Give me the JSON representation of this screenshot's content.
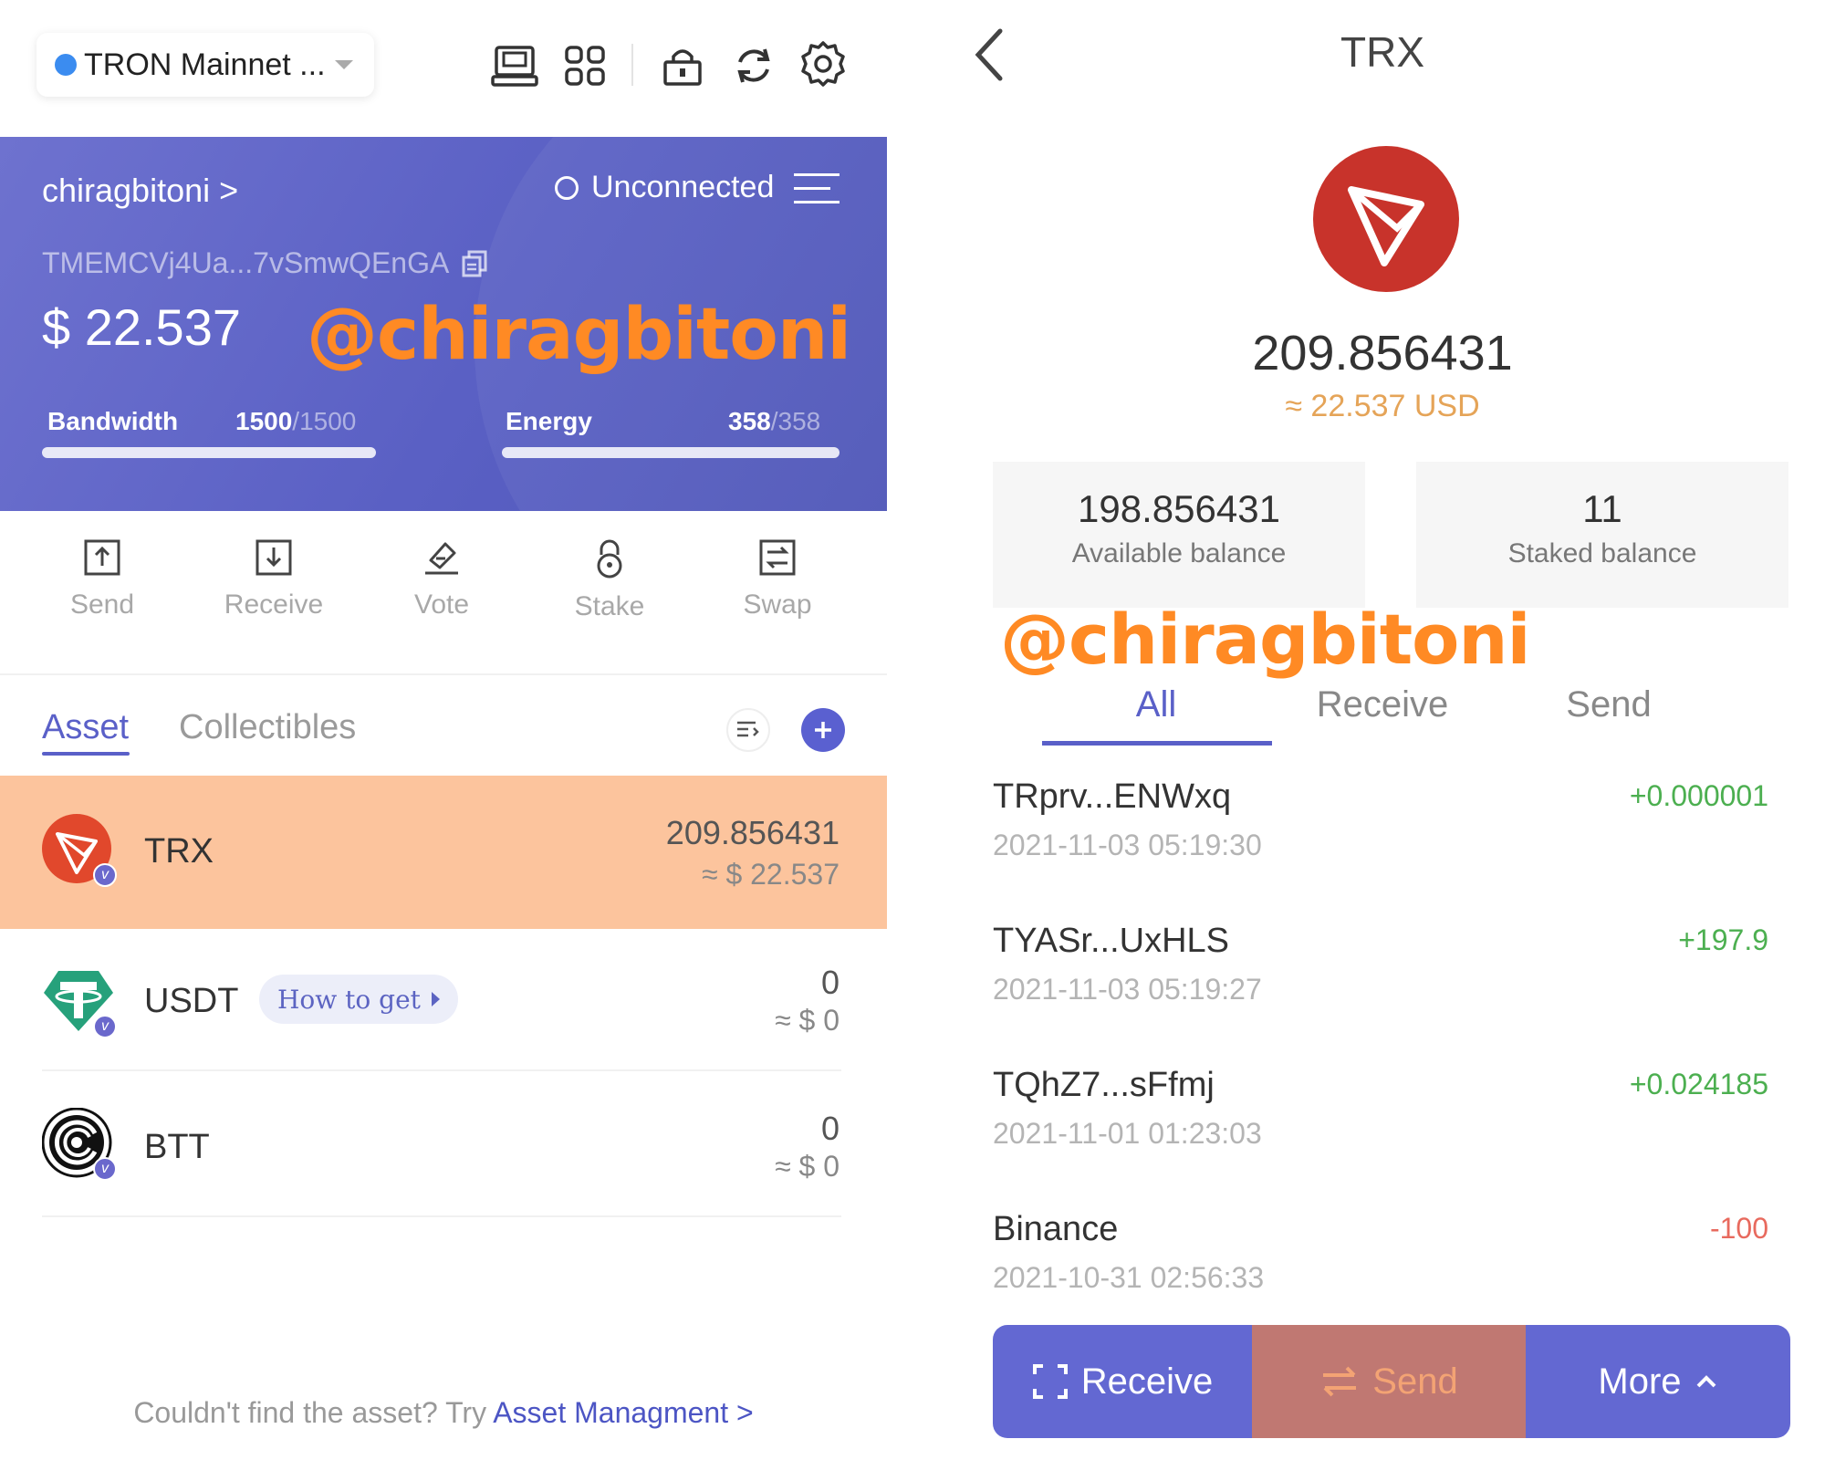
{
  "header": {
    "network": "TRON Mainnet ...",
    "icons": [
      "device-icon",
      "apps-grid-icon",
      "lock-icon",
      "refresh-icon",
      "gear-icon"
    ]
  },
  "account": {
    "name": "chiragbitoni >",
    "status": "Unconnected",
    "address": "TMEMCVj4Ua...7vSmwQEnGA",
    "balance": "$ 22.537",
    "watermark": "@chiragbitoni",
    "bandwidth": {
      "label": "Bandwidth",
      "value": "1500",
      "max": "/1500",
      "fraction": 1.0
    },
    "energy": {
      "label": "Energy",
      "value": "358",
      "max": "/358",
      "fraction": 1.0
    }
  },
  "actions": [
    {
      "label": "Send",
      "icon": "send-upload-icon"
    },
    {
      "label": "Receive",
      "icon": "receive-download-icon"
    },
    {
      "label": "Vote",
      "icon": "vote-icon"
    },
    {
      "label": "Stake",
      "icon": "lock-icon"
    },
    {
      "label": "Swap",
      "icon": "swap-icon"
    }
  ],
  "asset_tabs": {
    "asset": "Asset",
    "collectibles": "Collectibles"
  },
  "assets": [
    {
      "symbol": "TRX",
      "amount": "209.856431",
      "usd": "≈ $ 22.537",
      "selected": true
    },
    {
      "symbol": "USDT",
      "amount": "0",
      "usd": "≈ $ 0",
      "how_to_get": "How to get"
    },
    {
      "symbol": "BTT",
      "amount": "0",
      "usd": "≈ $ 0"
    }
  ],
  "footer": {
    "text": "Couldn't find the asset? Try ",
    "link": "Asset Managment >"
  },
  "detail": {
    "title": "TRX",
    "amount": "209.856431",
    "usd": "≈ 22.537 USD",
    "available": {
      "value": "198.856431",
      "label": "Available balance"
    },
    "staked": {
      "value": "11",
      "label": "Staked balance"
    },
    "watermark": "@chiragbitoni",
    "tabs": [
      "All",
      "Receive",
      "Send"
    ],
    "transactions": [
      {
        "address": "TRprv...ENWxq",
        "time": "2021-11-03 05:19:30",
        "amount": "+0.000001",
        "direction": "in"
      },
      {
        "address": "TYASr...UxHLS",
        "time": "2021-11-03 05:19:27",
        "amount": "+197.9",
        "direction": "in"
      },
      {
        "address": "TQhZ7...sFfmj",
        "time": "2021-11-01 01:23:03",
        "amount": "+0.024185",
        "direction": "in"
      },
      {
        "address": "Binance",
        "time": "2021-10-31 02:56:33",
        "amount": "-100",
        "direction": "out"
      }
    ],
    "bottom": {
      "receive": "Receive",
      "send": "Send",
      "more": "More"
    }
  },
  "colors": {
    "accent": "#5a60c8",
    "card_gradient": [
      "#6e72cf",
      "#4f56b8"
    ],
    "selected_row": "#fcc49d",
    "watermark": "#ff8a24",
    "positive": "#4caf50",
    "negative": "#e86a5e",
    "trx_red": "#c8332b"
  }
}
